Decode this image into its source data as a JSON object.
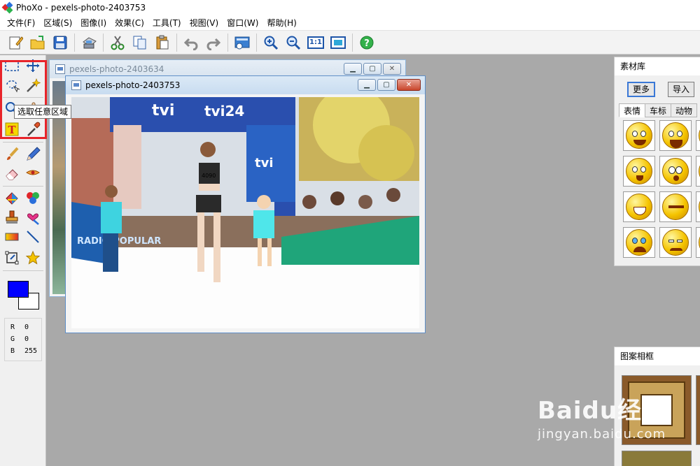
{
  "window": {
    "title": "PhoXo - pexels-photo-2403753"
  },
  "menu": [
    "文件(F)",
    "区域(S)",
    "图像(I)",
    "效果(C)",
    "工具(T)",
    "视图(V)",
    "窗口(W)",
    "帮助(H)"
  ],
  "toolbar": [
    {
      "icon": "new-document-icon"
    },
    {
      "icon": "open-folder-icon"
    },
    {
      "icon": "save-icon"
    },
    {
      "icon": "print-icon"
    },
    {
      "icon": "cut-icon"
    },
    {
      "icon": "copy-icon"
    },
    {
      "icon": "paste-icon"
    },
    {
      "icon": "undo-icon"
    },
    {
      "icon": "redo-icon"
    },
    {
      "icon": "image-settings-icon"
    },
    {
      "icon": "zoom-in-icon"
    },
    {
      "icon": "zoom-out-icon"
    },
    {
      "icon": "actual-size-icon",
      "label": "1:1"
    },
    {
      "icon": "fit-window-icon"
    },
    {
      "icon": "help-icon"
    }
  ],
  "palette": {
    "tooltip": "选取任意区域",
    "tools": [
      "rect-select-icon",
      "move-icon",
      "lasso-select-icon",
      "magic-wand-icon",
      "zoom-tool-icon",
      "hand-tool-icon",
      "text-tool-icon",
      "eyedropper-icon",
      "brush-icon",
      "pencil-icon",
      "eraser-icon",
      "smudge-icon",
      "color-fill-icon",
      "color-palette-icon",
      "clone-stamp-icon",
      "heart-brush-icon",
      "gradient-icon",
      "line-tool-icon",
      "transform-icon",
      "star-shape-icon"
    ],
    "foreground": "#0000ff",
    "background": "#ffffff",
    "rgb": [
      {
        "k": "R",
        "v": "0"
      },
      {
        "k": "G",
        "v": "0"
      },
      {
        "k": "B",
        "v": "255"
      }
    ]
  },
  "documents": {
    "back": {
      "title": "pexels-photo-2403634"
    },
    "front": {
      "title": "pexels-photo-2403753"
    }
  },
  "photo_signs": {
    "left": "tvi",
    "right": "tvi24",
    "banner": "tvi",
    "bib": "4090",
    "sign2": "RADIO POPULAR"
  },
  "assets_panel": {
    "title": "素材库",
    "more": "更多",
    "import": "导入",
    "tabs": [
      "表情",
      "车标",
      "动物"
    ]
  },
  "frames_panel": {
    "title": "图案相框"
  },
  "watermark": {
    "brand": "Baidu经验",
    "url": "jingyan.baidu.com"
  }
}
